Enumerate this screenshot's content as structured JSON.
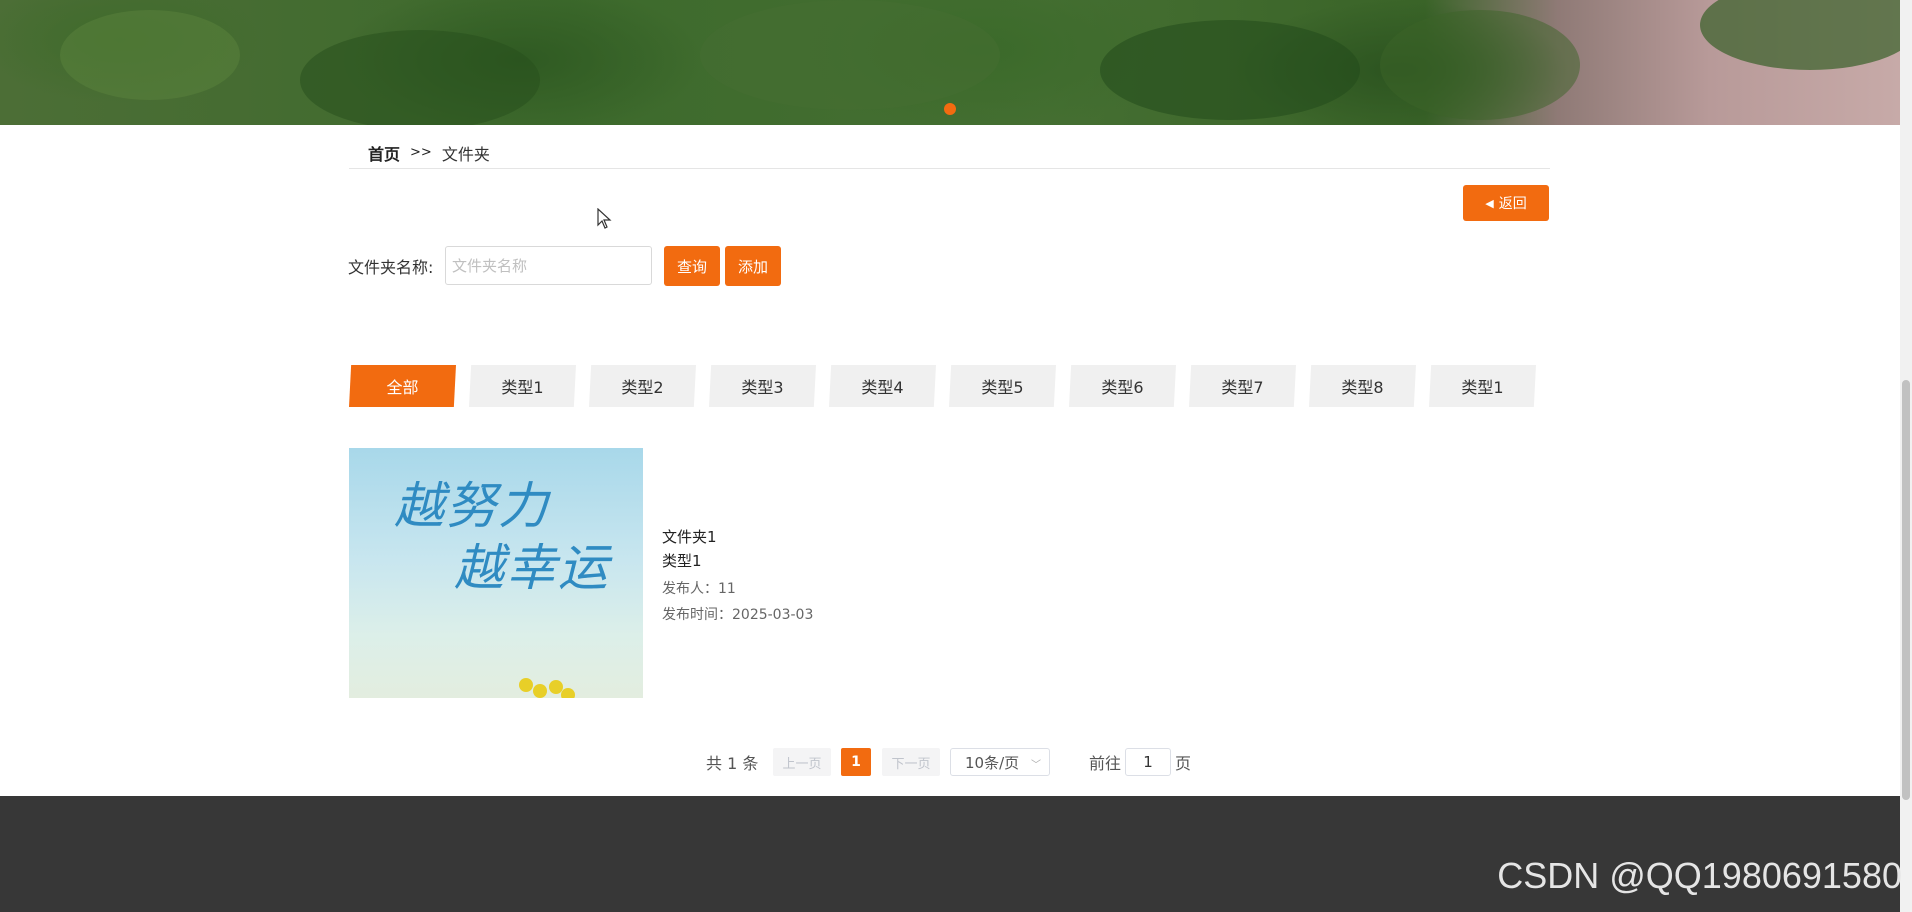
{
  "breadcrumb": {
    "home": "首页",
    "sep": ">>",
    "current": "文件夹"
  },
  "back_button": {
    "label": "返回",
    "icon": "caret-left-icon"
  },
  "search": {
    "label": "文件夹名称:",
    "placeholder": "文件夹名称",
    "value": "",
    "query_label": "查询",
    "add_label": "添加"
  },
  "tabs": [
    {
      "label": "全部",
      "active": true
    },
    {
      "label": "类型1"
    },
    {
      "label": "类型2"
    },
    {
      "label": "类型3"
    },
    {
      "label": "类型4"
    },
    {
      "label": "类型5"
    },
    {
      "label": "类型6"
    },
    {
      "label": "类型7"
    },
    {
      "label": "类型8"
    },
    {
      "label": "类型1"
    }
  ],
  "items": [
    {
      "image_text_line1": "越努力",
      "image_text_line2": "越幸运",
      "name": "文件夹1",
      "type": "类型1",
      "author": "发布人：11",
      "time": "发布时间：2025-03-03"
    }
  ],
  "pagination": {
    "total": "共 1 条",
    "prev": "上一页",
    "current": "1",
    "next": "下一页",
    "page_size": "10条/页",
    "goto_label": "前往",
    "goto_value": "1",
    "goto_unit": "页"
  },
  "watermark": "CSDN @QQ1980691580",
  "colors": {
    "accent": "#f26b10",
    "footer": "#373737"
  }
}
